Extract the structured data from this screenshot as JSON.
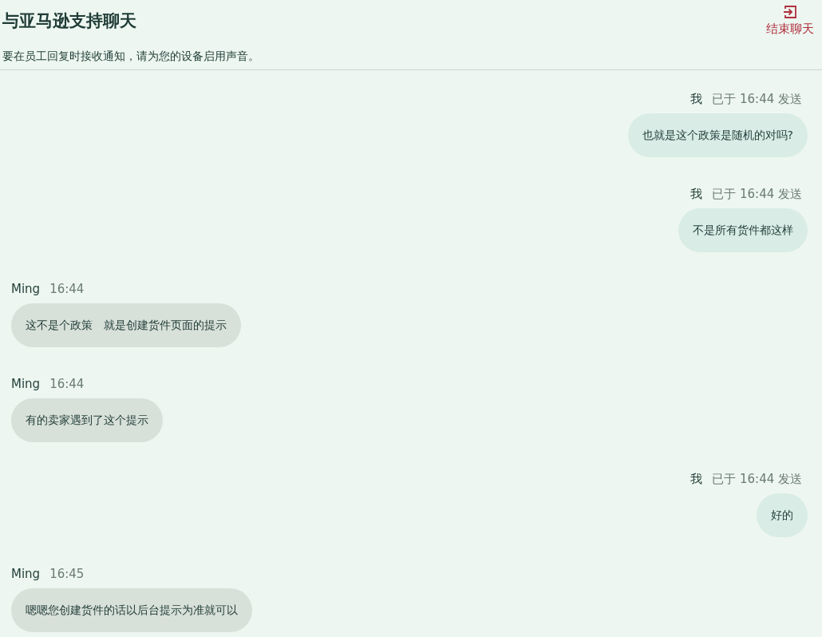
{
  "header": {
    "title": "与亚马逊支持聊天",
    "notice": "要在员工回复时接收通知，请为您的设备启用声音。",
    "end_button": "结束聊天"
  },
  "messages": [
    {
      "kind": "sent",
      "sender": "我",
      "meta": "已于 16:44 发送",
      "text": "也就是这个政策是随机的对吗?"
    },
    {
      "kind": "sent",
      "sender": "我",
      "meta": "已于 16:44 发送",
      "text": "不是所有货件都这样"
    },
    {
      "kind": "received",
      "sender": "Ming",
      "meta": "16:44",
      "text": "这不是个政策　就是创建货件页面的提示"
    },
    {
      "kind": "received",
      "sender": "Ming",
      "meta": "16:44",
      "text": "有的卖家遇到了这个提示"
    },
    {
      "kind": "sent",
      "sender": "我",
      "meta": "已于 16:44 发送",
      "text": "好的"
    },
    {
      "kind": "received",
      "sender": "Ming",
      "meta": "16:45",
      "text": "嗯嗯您创建货件的话以后台提示为准就可以"
    }
  ]
}
